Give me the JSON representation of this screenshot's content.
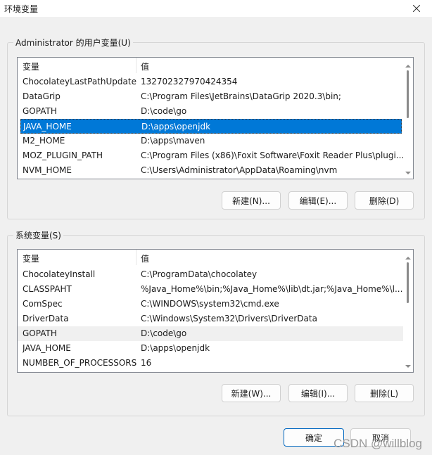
{
  "window": {
    "title": "环境变量"
  },
  "user_group": {
    "title": "Administrator 的用户变量(U)",
    "columns": [
      "变量",
      "值"
    ],
    "rows": [
      {
        "name": "ChocolateyLastPathUpdate",
        "value": "132702327970424354"
      },
      {
        "name": "DataGrip",
        "value": "C:\\Program Files\\JetBrains\\DataGrip 2020.3\\bin;"
      },
      {
        "name": "GOPATH",
        "value": "D:\\code\\go"
      },
      {
        "name": "JAVA_HOME",
        "value": "D:\\apps\\openjdk"
      },
      {
        "name": "M2_HOME",
        "value": "D:\\apps\\maven"
      },
      {
        "name": "MOZ_PLUGIN_PATH",
        "value": "C:\\Program Files (x86)\\Foxit Software\\Foxit Reader Plus\\plugi..."
      },
      {
        "name": "NVM_HOME",
        "value": "C:\\Users\\Administrator\\AppData\\Roaming\\nvm"
      }
    ],
    "buttons": {
      "new": "新建(N)...",
      "edit": "编辑(E)...",
      "delete": "删除(D)"
    }
  },
  "system_group": {
    "title": "系统变量(S)",
    "columns": [
      "变量",
      "值"
    ],
    "rows": [
      {
        "name": "ChocolateyInstall",
        "value": "C:\\ProgramData\\chocolatey"
      },
      {
        "name": "CLASSPAHT",
        "value": " %Java_Home%\\bin;%Java_Home%\\lib\\dt.jar;%Java_Home%\\l..."
      },
      {
        "name": "ComSpec",
        "value": "C:\\WINDOWS\\system32\\cmd.exe"
      },
      {
        "name": "DriverData",
        "value": "C:\\Windows\\System32\\Drivers\\DriverData"
      },
      {
        "name": "GOPATH",
        "value": "D:\\code\\go"
      },
      {
        "name": "JAVA_HOME",
        "value": "D:\\apps\\openjdk"
      },
      {
        "name": "NUMBER_OF_PROCESSORS",
        "value": "16"
      }
    ],
    "buttons": {
      "new": "新建(W)...",
      "edit": "编辑(I)...",
      "delete": "删除(L)"
    }
  },
  "footer": {
    "ok": "确定",
    "cancel": "取消"
  },
  "watermark": "CSDN @willblog"
}
